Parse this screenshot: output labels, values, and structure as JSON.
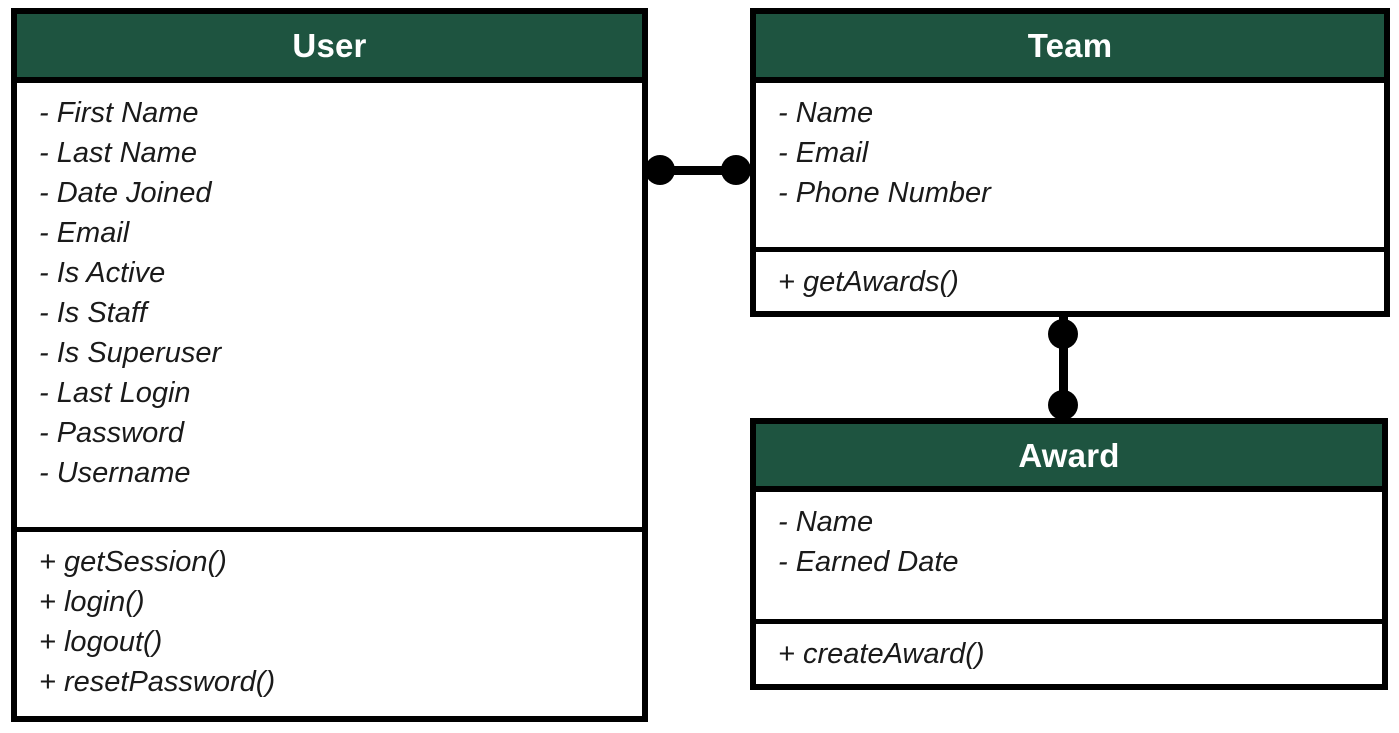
{
  "diagram": {
    "type": "uml-class-diagram",
    "colors": {
      "header_background": "#1e5440",
      "header_text": "#ffffff",
      "border": "#000000",
      "body_background": "#ffffff",
      "connector": "#000000"
    },
    "classes": [
      {
        "id": "user",
        "name": "User",
        "attributes": [
          "- First Name",
          "- Last Name",
          "- Date Joined",
          "- Email",
          "- Is Active",
          "- Is Staff",
          "- Is Superuser",
          "- Last Login",
          "- Password",
          "- Username"
        ],
        "methods": [
          "+ getSession()",
          "+ login()",
          "+ logout()",
          "+ resetPassword()"
        ]
      },
      {
        "id": "team",
        "name": "Team",
        "attributes": [
          "- Name",
          "- Email",
          "- Phone Number"
        ],
        "methods": [
          "+ getAwards()"
        ]
      },
      {
        "id": "award",
        "name": "Award",
        "attributes": [
          "- Name",
          "- Earned Date"
        ],
        "methods": [
          "+ createAward()"
        ]
      }
    ],
    "relationships": [
      {
        "id": "user-team",
        "from": "User",
        "to": "Team",
        "orientation": "horizontal",
        "from_endpoint": "filled-circle",
        "to_endpoint": "filled-circle"
      },
      {
        "id": "team-award",
        "from": "Team",
        "to": "Award",
        "orientation": "vertical",
        "from_endpoint": "filled-circle",
        "to_endpoint": "filled-circle"
      }
    ]
  }
}
